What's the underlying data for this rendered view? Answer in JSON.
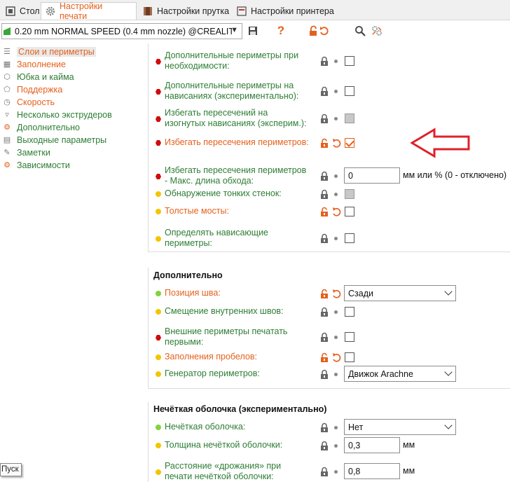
{
  "tabs": [
    {
      "label": "Стол",
      "active": false,
      "icon": "plate-icon"
    },
    {
      "label": "Настройки печати",
      "active": true,
      "icon": "gear-icon"
    },
    {
      "label": "Настройки прутка",
      "active": false,
      "icon": "filament-spool-icon"
    },
    {
      "label": "Настройки принтера",
      "active": false,
      "icon": "printer-icon"
    }
  ],
  "toolbar": {
    "preset_value": "0.20 mm NORMAL SPEED (0.4 mm nozzle) @CREALIT...",
    "icons": [
      "save-icon",
      "question-icon",
      "lock-undo-icon",
      "search-icon",
      "settings-compare-icon"
    ]
  },
  "sidebar": {
    "items": [
      {
        "label": "Слои и периметры",
        "color": "#e4611c",
        "icon": "layers-icon",
        "selected": true
      },
      {
        "label": "Заполнение",
        "color": "#e4611c",
        "icon": "infill-icon",
        "selected": false
      },
      {
        "label": "Юбка и кайма",
        "color": "#2d7d34",
        "icon": "skirt-icon",
        "selected": false
      },
      {
        "label": "Поддержка",
        "color": "#e4611c",
        "icon": "support-icon",
        "selected": false
      },
      {
        "label": "Скорость",
        "color": "#e4611c",
        "icon": "speed-icon",
        "selected": false
      },
      {
        "label": "Несколько экструдеров",
        "color": "#2d7d34",
        "icon": "extruders-icon",
        "selected": false
      },
      {
        "label": "Дополнительно",
        "color": "#2d7d34",
        "icon": "advanced-icon",
        "selected": false
      },
      {
        "label": "Выходные параметры",
        "color": "#2d7d34",
        "icon": "output-icon",
        "selected": false
      },
      {
        "label": "Заметки",
        "color": "#2d7d34",
        "icon": "notes-icon",
        "selected": false
      },
      {
        "label": "Зависимости",
        "color": "#2d7d34",
        "icon": "dependencies-icon",
        "selected": false
      }
    ]
  },
  "section1": {
    "rows": [
      {
        "label1": "Дополнительные периметры при",
        "label2": "необходимости:",
        "dot": "red",
        "color": "#2d7d34",
        "lock": "locked",
        "control": "checkbox",
        "value": "unchecked"
      },
      {
        "label1": "Дополнительные периметры на",
        "label2": "нависаниях (экспериментально):",
        "dot": "red",
        "color": "#2d7d34",
        "lock": "locked",
        "control": "checkbox",
        "value": "unchecked"
      },
      {
        "label1": "Избегать пересечений на",
        "label2": "изогнутых нависаниях (эксперим.):",
        "dot": "red",
        "color": "#2d7d34",
        "lock": "locked",
        "control": "checkbox",
        "value": "gray"
      },
      {
        "label1": "Избегать пересечения периметров:",
        "label2": "",
        "dot": "red",
        "color": "#e4611c",
        "lock": "unlocked",
        "control": "checkbox",
        "value": "checked"
      },
      {
        "label1": "Избегать пересечения периметров",
        "label2": "- Макс. длина обхода:",
        "dot": "red",
        "color": "#2d7d34",
        "lock": "locked",
        "control": "input",
        "value": "0",
        "unit": "мм или % (0 - отключено)"
      },
      {
        "label1": "Обнаружение тонких стенок:",
        "label2": "",
        "dot": "yellow",
        "color": "#2d7d34",
        "lock": "locked",
        "control": "checkbox",
        "value": "gray"
      },
      {
        "label1": "Толстые мосты:",
        "label2": "",
        "dot": "yellow",
        "color": "#e4611c",
        "lock": "unlocked",
        "control": "checkbox",
        "value": "unchecked"
      },
      {
        "label1": "Определять нависающие",
        "label2": "периметры:",
        "dot": "yellow",
        "color": "#2d7d34",
        "lock": "locked",
        "control": "checkbox",
        "value": "unchecked"
      }
    ]
  },
  "section2": {
    "title": "Дополнительно",
    "rows": [
      {
        "label1": "Позиция шва:",
        "label2": "",
        "dot": "green",
        "color": "#e4611c",
        "lock": "unlocked",
        "control": "select",
        "value": "Сзади"
      },
      {
        "label1": "Смещение внутренних швов:",
        "label2": "",
        "dot": "yellow",
        "color": "#2d7d34",
        "lock": "locked",
        "control": "checkbox",
        "value": "unchecked"
      },
      {
        "label1": "Внешние периметры печатать",
        "label2": "первыми:",
        "dot": "red",
        "color": "#2d7d34",
        "lock": "locked",
        "control": "checkbox",
        "value": "unchecked"
      },
      {
        "label1": "Заполнения пробелов:",
        "label2": "",
        "dot": "yellow",
        "color": "#e4611c",
        "lock": "unlocked",
        "control": "checkbox",
        "value": "unchecked"
      },
      {
        "label1": "Генератор периметров:",
        "label2": "",
        "dot": "yellow",
        "color": "#2d7d34",
        "lock": "locked",
        "control": "select",
        "value": "Движок Arachne"
      }
    ]
  },
  "section3": {
    "title": "Нечёткая оболочка (экспериментально)",
    "rows": [
      {
        "label1": "Нечёткая оболочка:",
        "label2": "",
        "dot": "green",
        "color": "#2d7d34",
        "lock": "locked",
        "control": "select",
        "value": "Нет"
      },
      {
        "label1": "Толщина нечёткой оболочки:",
        "label2": "",
        "dot": "yellow",
        "color": "#2d7d34",
        "lock": "locked",
        "control": "input",
        "value": "0,3",
        "unit": "мм"
      },
      {
        "label1": "Расстояние «дрожания» при",
        "label2": "печати нечёткой оболочки:",
        "dot": "yellow",
        "color": "#2d7d34",
        "lock": "locked",
        "control": "input",
        "value": "0,8",
        "unit": "мм"
      }
    ]
  },
  "annotation_arrow_color": "#e0202a",
  "tooltip": "Пуск"
}
